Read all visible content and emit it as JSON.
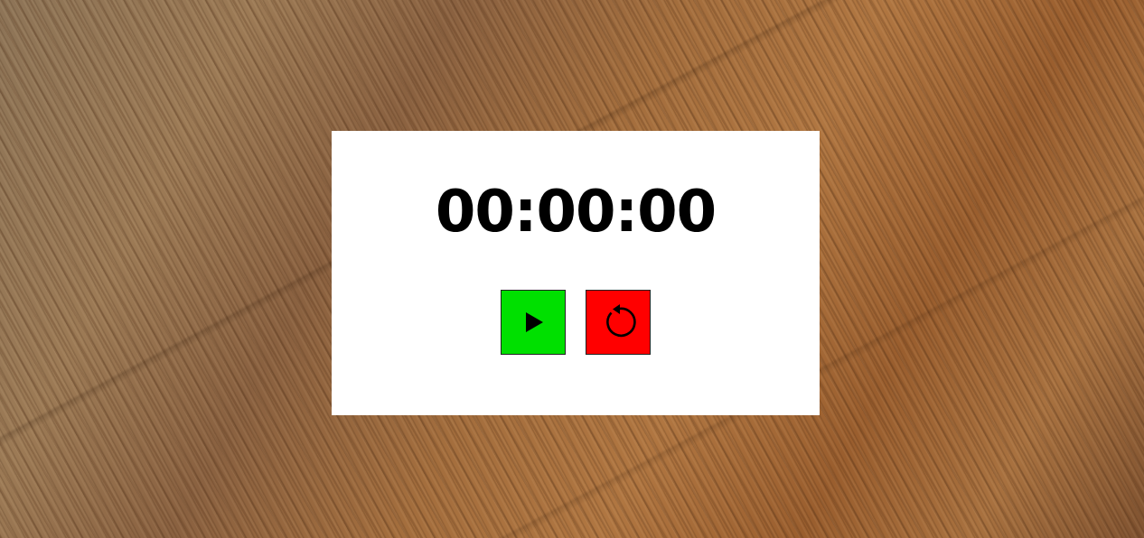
{
  "stopwatch": {
    "time": "00:00:00",
    "start_icon": "play-icon",
    "reset_icon": "reset-icon"
  },
  "colors": {
    "start_button": "#00e000",
    "reset_button": "#ff0000",
    "card_background": "#ffffff",
    "text": "#000000"
  }
}
